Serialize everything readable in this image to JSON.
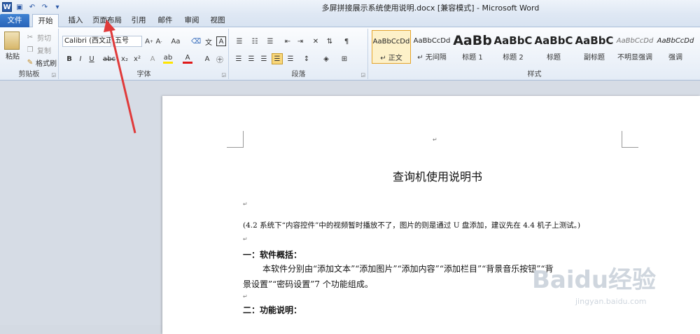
{
  "titlebar": {
    "title": "多屏拼接展示系统使用说明.docx [兼容模式] - Microsoft Word",
    "word_icon": "W",
    "save_icon": "save-icon",
    "undo_icon": "undo-icon",
    "redo_icon": "redo-icon"
  },
  "tabs": [
    "文件",
    "开始",
    "插入",
    "页面布局",
    "引用",
    "邮件",
    "审阅",
    "视图"
  ],
  "clipboard": {
    "paste": "粘贴",
    "cut": "剪切",
    "copy": "复制",
    "format_painter": "格式刷",
    "label": "剪贴板"
  },
  "font": {
    "name": "Calibri (西文正",
    "size": "五号",
    "label": "字体"
  },
  "paragraph": {
    "label": "段落"
  },
  "styles": {
    "label": "样式",
    "items": [
      {
        "preview": "AaBbCcDd",
        "label": "↵ 正文"
      },
      {
        "preview": "AaBbCcDd",
        "label": "↵ 无间隔"
      },
      {
        "preview": "AaBb",
        "label": "标题 1"
      },
      {
        "preview": "AaBbC",
        "label": "标题 2"
      },
      {
        "preview": "AaBbC",
        "label": "标题"
      },
      {
        "preview": "AaBbC",
        "label": "副标题"
      },
      {
        "preview": "AaBbCcDd",
        "label": "不明显强调"
      },
      {
        "preview": "AaBbCcDd",
        "label": "强调"
      }
    ]
  },
  "document": {
    "title": "查询机使用说明书",
    "note": "(4.2 系统下“内容控件”中的视频暂时播放不了，图片的则是通过 U 盘添加，建议先在 4.4 机子上测试。)",
    "h1": "一：软件概括：",
    "body1": "本软件分别由“添加文本”“添加图片”“添加内容”“添加栏目”“背景音乐按钮”“背",
    "body2": "景设置”“密码设置”7 个功能组成。",
    "h2": "二：功能说明：",
    "mark": "↵"
  },
  "watermark": {
    "text": "Baidu经验",
    "url": "jingyan.baidu.com"
  },
  "colors": {
    "accent": "#2a64b8",
    "arrow": "#e03a3a"
  }
}
